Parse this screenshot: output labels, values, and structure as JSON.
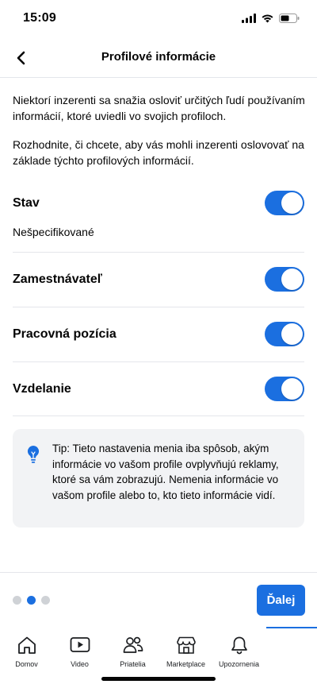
{
  "status_bar": {
    "time": "15:09"
  },
  "header": {
    "title": "Profilové informácie"
  },
  "intro": {
    "paragraph1": "Niektorí inzerenti sa snažia osloviť určitých ľudí používaním informácií, ktoré uviedli vo svojich profiloch.",
    "paragraph2": "Rozhodnite, či chcete, aby vás mohli inzerenti oslovovať na základe týchto profilových informácií."
  },
  "settings": [
    {
      "label": "Stav",
      "value": "Nešpecifikované",
      "enabled": true
    },
    {
      "label": "Zamestnávateľ",
      "enabled": true
    },
    {
      "label": "Pracovná pozícia",
      "enabled": true
    },
    {
      "label": "Vzdelanie",
      "enabled": true
    }
  ],
  "tip": {
    "text": "Tip: Tieto nastavenia menia iba spôsob, akým informácie vo vašom profile ovplyvňujú reklamy, ktoré sa vám zobrazujú. Nemenia informácie vo vašom profile alebo to, kto tieto informácie vidí."
  },
  "pagination": {
    "total": 3,
    "active_index": 1
  },
  "next_button": {
    "label": "Ďalej"
  },
  "tab_bar": [
    {
      "label": "Domov",
      "icon": "home-icon"
    },
    {
      "label": "Video",
      "icon": "video-icon"
    },
    {
      "label": "Priatelia",
      "icon": "friends-icon"
    },
    {
      "label": "Marketplace",
      "icon": "marketplace-icon"
    },
    {
      "label": "Upozornenia",
      "icon": "bell-icon"
    }
  ],
  "colors": {
    "accent": "#1b6fe0",
    "divider": "#e4e6eb",
    "tip_background": "#f2f3f5"
  }
}
